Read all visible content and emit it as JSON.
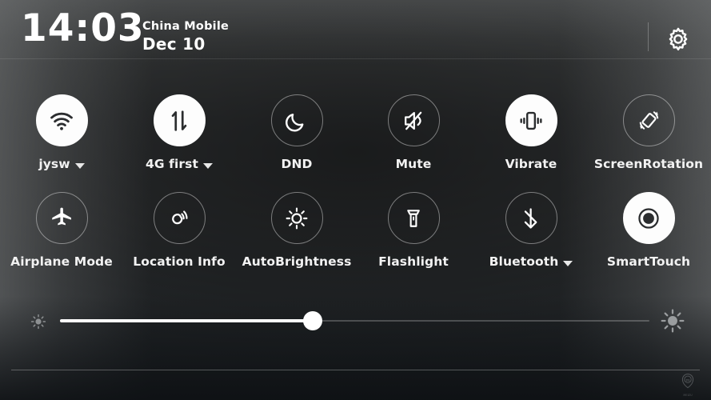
{
  "statusbar": {
    "time": "14:03",
    "carrier": "China Mobile",
    "date": "Dec 10",
    "settings_icon": "gear-icon"
  },
  "tiles": {
    "row1": [
      {
        "label": "jysw",
        "icon": "wifi-icon",
        "state": "on",
        "has_caret": true
      },
      {
        "label": "4G first",
        "icon": "mobile-data-icon",
        "state": "on",
        "has_caret": true
      },
      {
        "label": "DND",
        "icon": "moon-icon",
        "state": "off",
        "has_caret": false
      },
      {
        "label": "Mute",
        "icon": "speaker-mute-icon",
        "state": "off",
        "has_caret": false
      },
      {
        "label": "Vibrate",
        "icon": "vibrate-icon",
        "state": "on",
        "has_caret": false
      },
      {
        "label": "ScreenRotation",
        "icon": "screen-rotation-icon",
        "state": "off",
        "has_caret": false
      }
    ],
    "row2": [
      {
        "label": "Airplane Mode",
        "icon": "airplane-icon",
        "state": "off",
        "has_caret": false
      },
      {
        "label": "Location Info",
        "icon": "location-icon",
        "state": "off",
        "has_caret": false
      },
      {
        "label": "AutoBrightness",
        "icon": "sun-icon",
        "state": "off",
        "has_caret": false
      },
      {
        "label": "Flashlight",
        "icon": "flashlight-icon",
        "state": "off",
        "has_caret": false
      },
      {
        "label": "Bluetooth",
        "icon": "bluetooth-icon",
        "state": "off",
        "has_caret": true
      },
      {
        "label": "SmartTouch",
        "icon": "smart-touch-icon",
        "state": "on",
        "has_caret": false
      }
    ]
  },
  "brightness": {
    "low_icon": "sun-small-icon",
    "high_icon": "sun-large-icon",
    "value_percent": 43
  },
  "watermark": {
    "glyph": "m",
    "text": "MEIZU"
  },
  "colors": {
    "accent_on": "#fdfdfd",
    "icon_on": "#2b2d2f",
    "icon_off": "#ffffff",
    "label": "#f2f2f2",
    "bg_center": "#36393b",
    "bg_edge": "#6e7071"
  }
}
